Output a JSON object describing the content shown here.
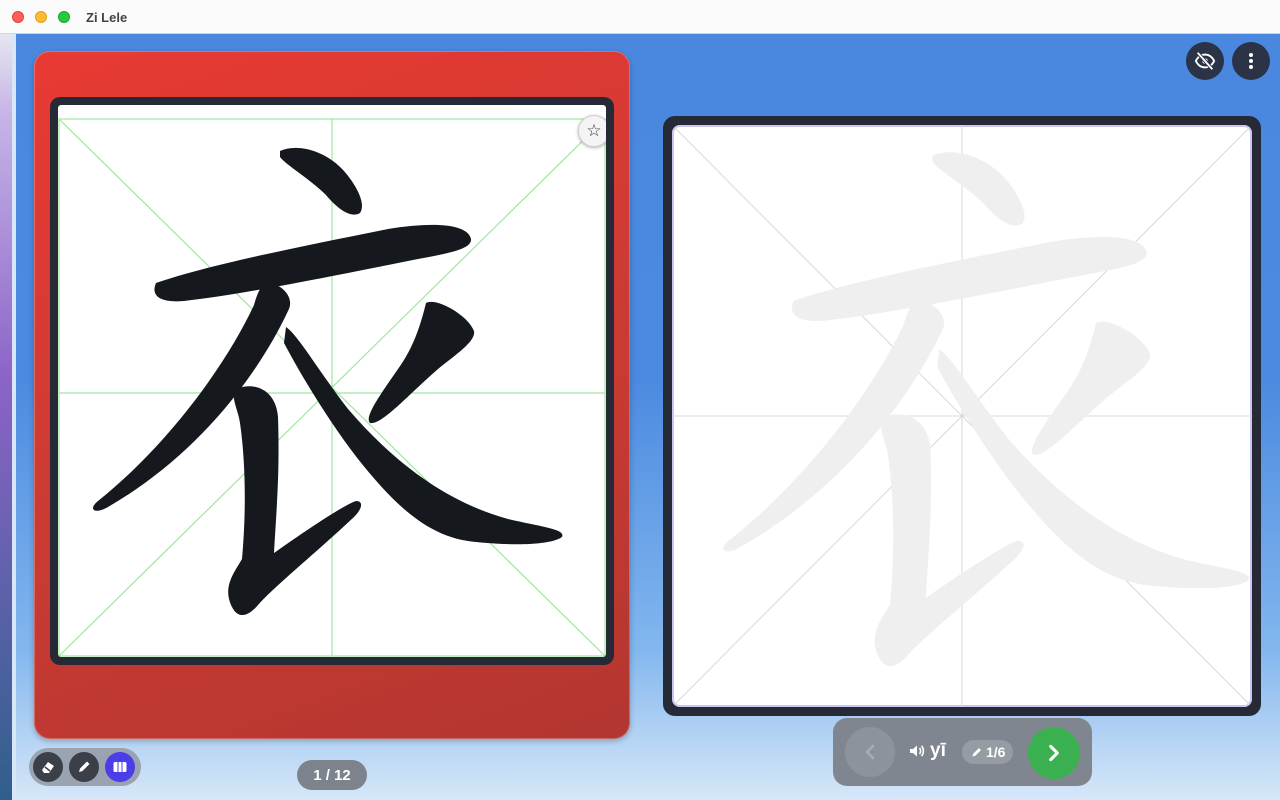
{
  "window": {
    "title": "Zi Lele"
  },
  "character": {
    "glyph": "衣",
    "pinyin": "yī"
  },
  "flashcard": {
    "color": "#d83a33",
    "star_icon": "star-outline-icon"
  },
  "practice": {
    "stroke_progress": "1/6"
  },
  "navigation": {
    "page_counter": "1 / 12"
  },
  "toolbar": {
    "tools": [
      {
        "name": "eraser-icon",
        "active": false
      },
      {
        "name": "pencil-icon",
        "active": false
      },
      {
        "name": "book-icon",
        "active": true
      }
    ]
  },
  "top_actions": {
    "hide_icon": "eye-off-icon",
    "menu_icon": "more-vertical-icon"
  },
  "colors": {
    "accent": "#4b3ee8",
    "next": "#3bb050",
    "frame": "#262a36",
    "grid": "#9ee89e"
  }
}
